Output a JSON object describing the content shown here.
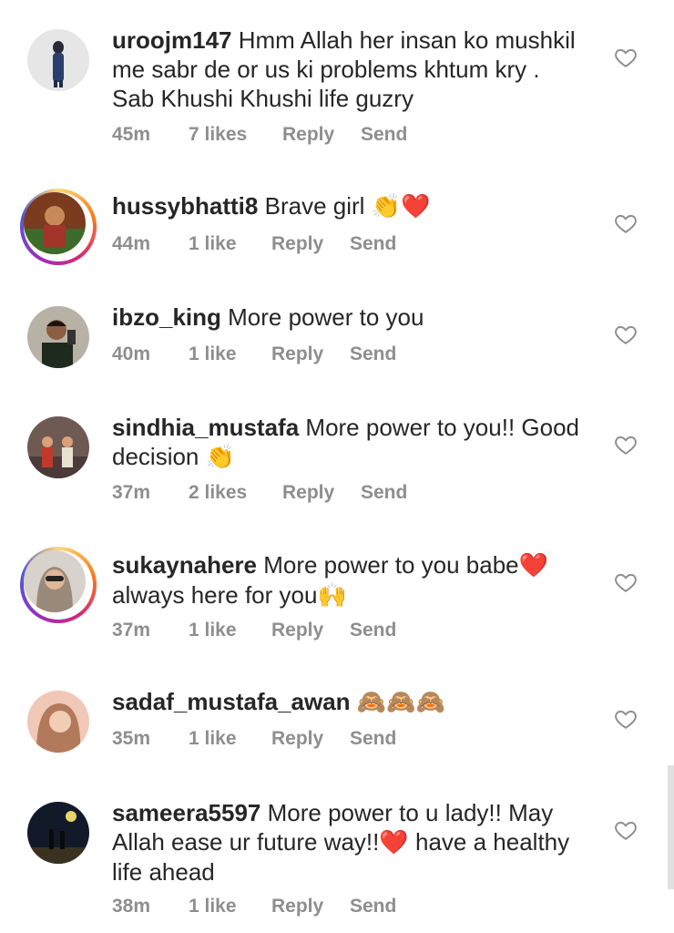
{
  "comments": [
    {
      "username": "uroojm147",
      "text": "Hmm Allah her insan ko mushkil me sabr de or us ki problems khtum kry . Sab Khushi Khushi life guzry",
      "emoji": "",
      "time": "45m",
      "likes": "7 likes",
      "reply": "Reply",
      "send": "Send",
      "ring": false,
      "avatar_icon": "person-standing-avatar"
    },
    {
      "username": "hussybhatti8",
      "text": "Brave girl",
      "emoji": "👏❤️",
      "time": "44m",
      "likes": "1 like",
      "reply": "Reply",
      "send": "Send",
      "ring": true,
      "avatar_icon": "person-selfie-avatar"
    },
    {
      "username": "ibzo_king",
      "text": "More power to you",
      "emoji": "",
      "time": "40m",
      "likes": "1 like",
      "reply": "Reply",
      "send": "Send",
      "ring": false,
      "avatar_icon": "man-selfie-avatar"
    },
    {
      "username": "sindhia_mustafa",
      "text": "More power to you!! Good decision",
      "emoji": "👏",
      "time": "37m",
      "likes": "2 likes",
      "reply": "Reply",
      "send": "Send",
      "ring": false,
      "avatar_icon": "group-photo-avatar"
    },
    {
      "username": "sukaynahere",
      "text": "More power to you babe",
      "emoji": "❤️",
      "text2": "always here for you",
      "emoji2": "🙌",
      "time": "37m",
      "likes": "1 like",
      "reply": "Reply",
      "send": "Send",
      "ring": true,
      "avatar_icon": "woman-sunglasses-avatar"
    },
    {
      "username": "sadaf_mustafa_awan",
      "text": "",
      "emoji": "🙈🙈🙈",
      "time": "35m",
      "likes": "1 like",
      "reply": "Reply",
      "send": "Send",
      "ring": false,
      "avatar_icon": "woman-portrait-avatar"
    },
    {
      "username": "sameera5597",
      "text": "More power to u lady!! May Allah ease ur future way!!",
      "emoji": "❤️",
      "text2": "have a healthy life ahead",
      "emoji2": "",
      "time": "38m",
      "likes": "1 like",
      "reply": "Reply",
      "send": "Send",
      "ring": false,
      "avatar_icon": "couple-night-avatar"
    }
  ],
  "colors": {
    "text": "#262626",
    "meta": "#8e8e8e",
    "heart_outline": "#8e8e8e",
    "ring_start": "#feda75",
    "ring_end": "#962fbf"
  }
}
